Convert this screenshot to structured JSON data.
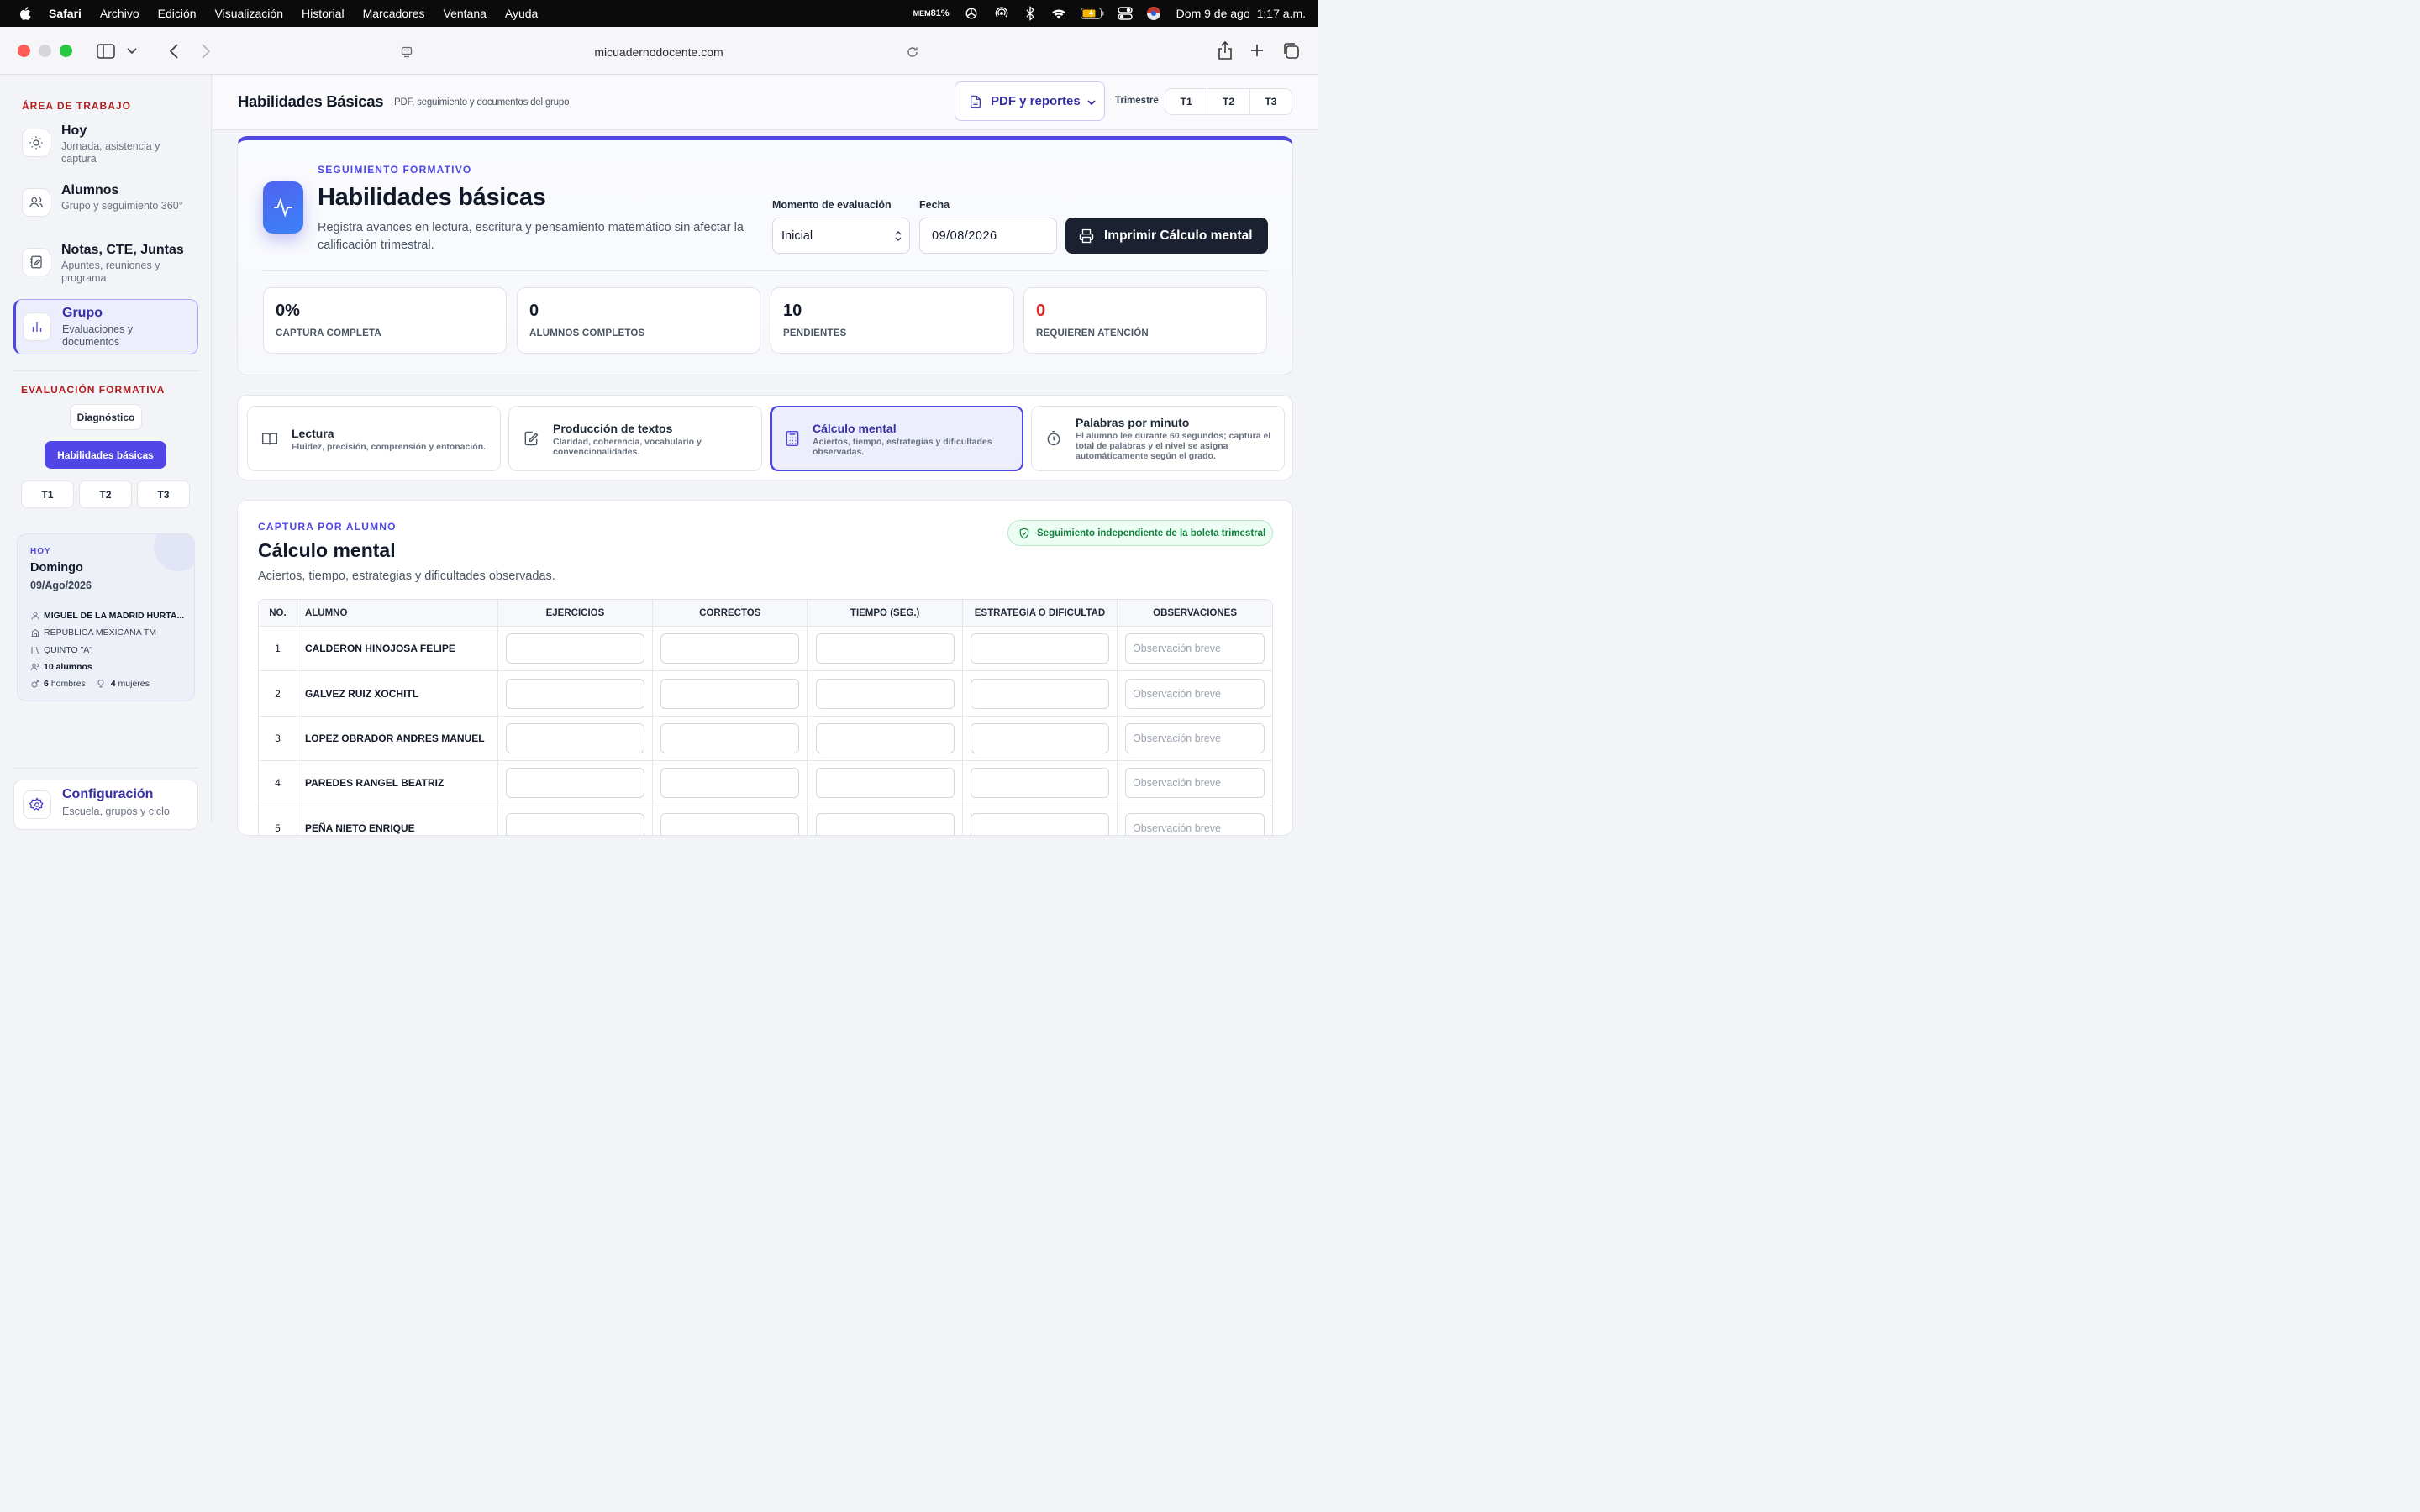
{
  "menubar": {
    "app": "Safari",
    "menus": [
      "Archivo",
      "Edición",
      "Visualización",
      "Historial",
      "Marcadores",
      "Ventana",
      "Ayuda"
    ],
    "mem_label": "MEM",
    "mem_value": "81%",
    "date": "Dom 9 de ago",
    "time": "1:17 a.m."
  },
  "browser": {
    "url": "micuadernodocente.com"
  },
  "sidebar": {
    "workspace_heading": "ÁREA DE TRABAJO",
    "items": [
      {
        "title": "Hoy",
        "subtitle": "Jornada, asistencia y captura",
        "icon": "sun-icon"
      },
      {
        "title": "Alumnos",
        "subtitle": "Grupo y seguimiento 360°",
        "icon": "users-icon"
      },
      {
        "title": "Notas, CTE, Juntas",
        "subtitle": "Apuntes, reuniones y programa",
        "icon": "notebook-icon"
      },
      {
        "title": "Grupo",
        "subtitle": "Evaluaciones y documentos",
        "icon": "bar-chart-icon",
        "active": true
      }
    ],
    "formative_heading": "EVALUACIÓN FORMATIVA",
    "diagnostico": "Diagnóstico",
    "habilidades": "Habilidades básicas",
    "trimesters": [
      "T1",
      "T2",
      "T3"
    ],
    "today": {
      "label": "HOY",
      "day": "Domingo",
      "date": "09/Ago/2026",
      "teacher": "MIGUEL DE LA MADRID HURTA...",
      "school": "REPUBLICA MEXICANA TM",
      "group": "QUINTO \"A\"",
      "students": "10 alumnos",
      "men_count": "6",
      "men_label": "hombres",
      "women_count": "4",
      "women_label": "mujeres"
    },
    "config": {
      "title": "Configuración",
      "subtitle": "Escuela, grupos y ciclo"
    }
  },
  "header": {
    "title": "Habilidades Básicas",
    "subtitle": "PDF, seguimiento y documentos del grupo",
    "pdf_button": "PDF y reportes",
    "trimestre_label": "Trimestre",
    "trimesters": [
      "T1",
      "T2",
      "T3"
    ]
  },
  "hero": {
    "eyebrow": "SEGUIMIENTO FORMATIVO",
    "title": "Habilidades básicas",
    "description": "Registra avances en lectura, escritura y pensamiento matemático sin afectar la calificación trimestral.",
    "moment_label": "Momento de evaluación",
    "moment_value": "Inicial",
    "date_label": "Fecha",
    "date_value": "09/08/2026",
    "print_button": "Imprimir Cálculo mental",
    "stats": [
      {
        "value": "0%",
        "label": "CAPTURA COMPLETA"
      },
      {
        "value": "0",
        "label": "ALUMNOS COMPLETOS"
      },
      {
        "value": "10",
        "label": "PENDIENTES"
      },
      {
        "value": "0",
        "label": "REQUIEREN ATENCIÓN"
      }
    ]
  },
  "modules": [
    {
      "title": "Lectura",
      "subtitle": "Fluidez, precisión, comprensión y entonación.",
      "icon": "book-icon"
    },
    {
      "title": "Producción de textos",
      "subtitle": "Claridad, coherencia, vocabulario y convencionalidades.",
      "icon": "edit-icon"
    },
    {
      "title": "Cálculo mental",
      "subtitle": "Aciertos, tiempo, estrategias y dificultades observadas.",
      "icon": "calculator-icon",
      "active": true
    },
    {
      "title": "Palabras por minuto",
      "subtitle": "El alumno lee durante 60 segundos; captura el total de palabras y el nivel se asigna automáticamente según el grado.",
      "icon": "stopwatch-icon"
    }
  ],
  "capture": {
    "eyebrow": "CAPTURA POR ALUMNO",
    "badge": "Seguimiento independiente de la boleta trimestral",
    "title": "Cálculo mental",
    "description": "Aciertos, tiempo, estrategias y dificultades observadas.",
    "columns": [
      "NO.",
      "ALUMNO",
      "EJERCICIOS",
      "CORRECTOS",
      "TIEMPO (SEG.)",
      "ESTRATEGIA O DIFICULTAD",
      "OBSERVACIONES"
    ],
    "placeholder": "Observación breve",
    "rows": [
      {
        "no": "1",
        "name": "CALDERON HINOJOSA FELIPE"
      },
      {
        "no": "2",
        "name": "GALVEZ RUIZ XOCHITL"
      },
      {
        "no": "3",
        "name": "LOPEZ OBRADOR ANDRES MANUEL"
      },
      {
        "no": "4",
        "name": "PAREDES RANGEL BEATRIZ"
      },
      {
        "no": "5",
        "name": "PEÑA NIETO ENRIQUE"
      }
    ]
  },
  "colors": {
    "accent": "#4f46e5",
    "danger": "#dc2626",
    "success": "#15803d",
    "sidebar_heading": "#b21f1f",
    "dark_button": "#1b2130"
  }
}
